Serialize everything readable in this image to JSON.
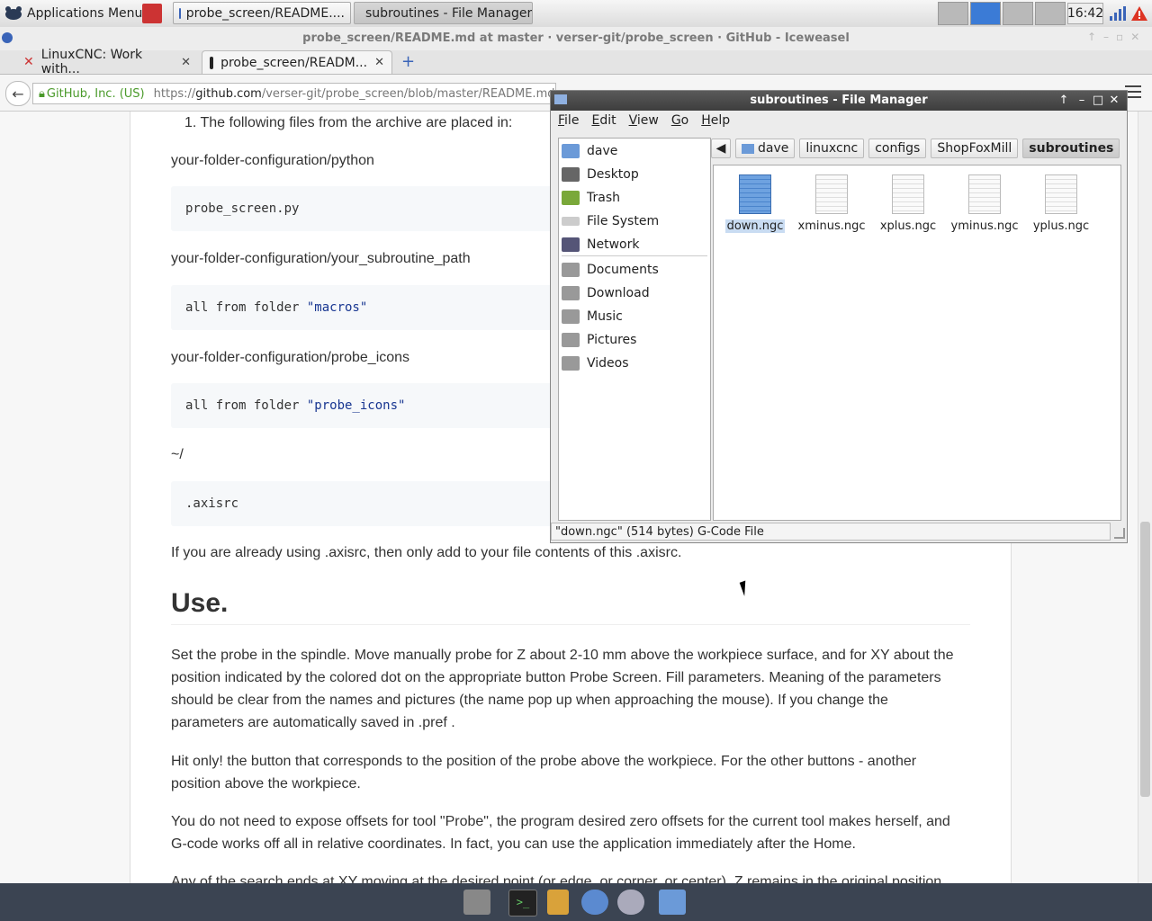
{
  "top_panel": {
    "apps_menu_label": "Applications Menu",
    "tasks": [
      {
        "label": "probe_screen/README...."
      },
      {
        "label": "subroutines - File Manager"
      }
    ],
    "clock": "16:42"
  },
  "browser": {
    "window_title": "probe_screen/README.md at master · verser-git/probe_screen · GitHub - Iceweasel",
    "tabs": [
      {
        "label": "LinuxCNC: Work with..."
      },
      {
        "label": "probe_screen/READM..."
      }
    ],
    "security_label": "GitHub, Inc. (US)",
    "url_prefix": "https://",
    "url_host": "github.com",
    "url_path": "/verser-git/probe_screen/blob/master/README.md"
  },
  "readme": {
    "list_item": "1. The following files from the archive are placed in:",
    "path_python": "your-folder-configuration/python",
    "code_python": "probe_screen.py",
    "path_subroutine": "your-folder-configuration/your_subroutine_path",
    "code_macros_prefix": "all from folder ",
    "code_macros_str": "\"macros\"",
    "path_icons": "your-folder-configuration/probe_icons",
    "code_icons_prefix": "all from folder ",
    "code_icons_str": "\"probe_icons\"",
    "home_path": "~/",
    "code_axisrc": ".axisrc",
    "axisrc_note": "If you are already using .axisrc, then only add to your file contents of this .axisrc.",
    "use_heading": "Use.",
    "para1": "Set the probe in the spindle. Move manually probe for Z about 2-10 mm above the workpiece surface, and for XY about the position indicated by the colored dot on the appropriate button Probe Screen. Fill parameters. Meaning of the parameters should be clear from the names and pictures (the name pop up when approaching the mouse). If you change the parameters are automatically saved in .pref .",
    "para2": "Hit only! the button that corresponds to the position of the probe above the workpiece. For the other buttons - another position above the workpiece.",
    "para3": "You do not need to expose offsets for tool \"Probe\", the program desired zero offsets for the current tool makes herself, and G-code works off all in relative coordinates. In fact, you can use the application immediately after the Home.",
    "para4": "Any of the search ends at XY moving at the desired point (or edge, or corner, or center), Z remains in the original position."
  },
  "file_manager": {
    "title": "subroutines - File Manager",
    "menu": [
      "File",
      "Edit",
      "View",
      "Go",
      "Help"
    ],
    "sidebar": [
      {
        "label": "dave",
        "icon": "home-folder-icon"
      },
      {
        "label": "Desktop",
        "icon": "desktop-icon"
      },
      {
        "label": "Trash",
        "icon": "trash-icon"
      },
      {
        "label": "File System",
        "icon": "drive-icon"
      },
      {
        "label": "Network",
        "icon": "network-icon"
      },
      {
        "label": "Documents",
        "icon": "folder-icon"
      },
      {
        "label": "Download",
        "icon": "folder-icon"
      },
      {
        "label": "Music",
        "icon": "folder-icon"
      },
      {
        "label": "Pictures",
        "icon": "folder-icon"
      },
      {
        "label": "Videos",
        "icon": "folder-icon"
      }
    ],
    "breadcrumbs": [
      "dave",
      "linuxcnc",
      "configs",
      "ShopFoxMill",
      "subroutines"
    ],
    "files": [
      {
        "name": "down.ngc",
        "selected": true
      },
      {
        "name": "xminus.ngc",
        "selected": false
      },
      {
        "name": "xplus.ngc",
        "selected": false
      },
      {
        "name": "yminus.ngc",
        "selected": false
      },
      {
        "name": "yplus.ngc",
        "selected": false
      }
    ],
    "status": "\"down.ngc\" (514 bytes) G-Code File"
  }
}
